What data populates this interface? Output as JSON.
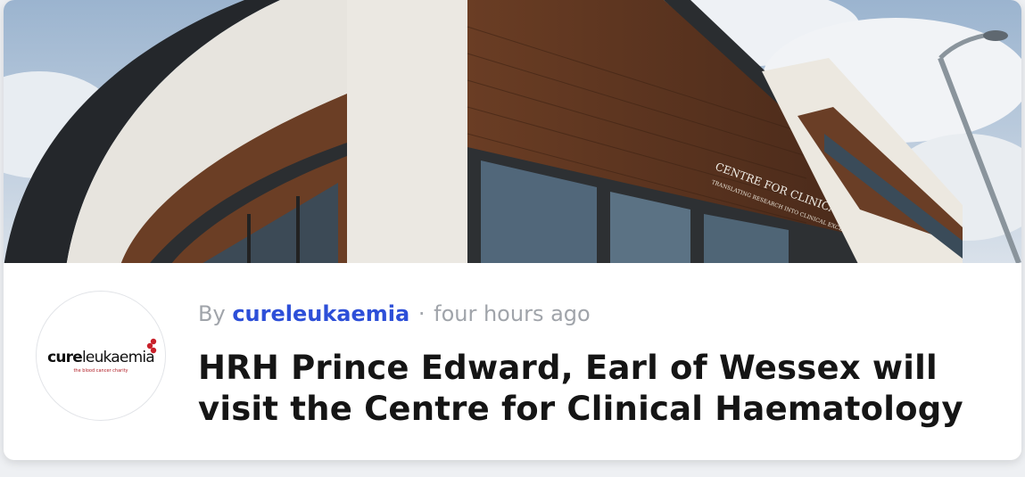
{
  "post": {
    "by_prefix": "By",
    "author": "cureleukaemia",
    "separator": "·",
    "time": "four hours ago",
    "title": "HRH Prince Edward, Earl of Wessex will visit the Centre for Clinical Haematology",
    "hero_sign_line1": "CENTRE FOR CLINICAL HAEMATOLOGY",
    "hero_sign_line2": "TRANSLATING RESEARCH INTO CLINICAL EXCELLENCE"
  },
  "avatar": {
    "logo_bold": "cure",
    "logo_light": "leukaemia",
    "logo_tagline": "the blood cancer charity"
  },
  "colors": {
    "author_link": "#2d4fd8",
    "meta_text": "#a0a4aa",
    "title_text": "#151515",
    "logo_accent": "#b01c24"
  }
}
